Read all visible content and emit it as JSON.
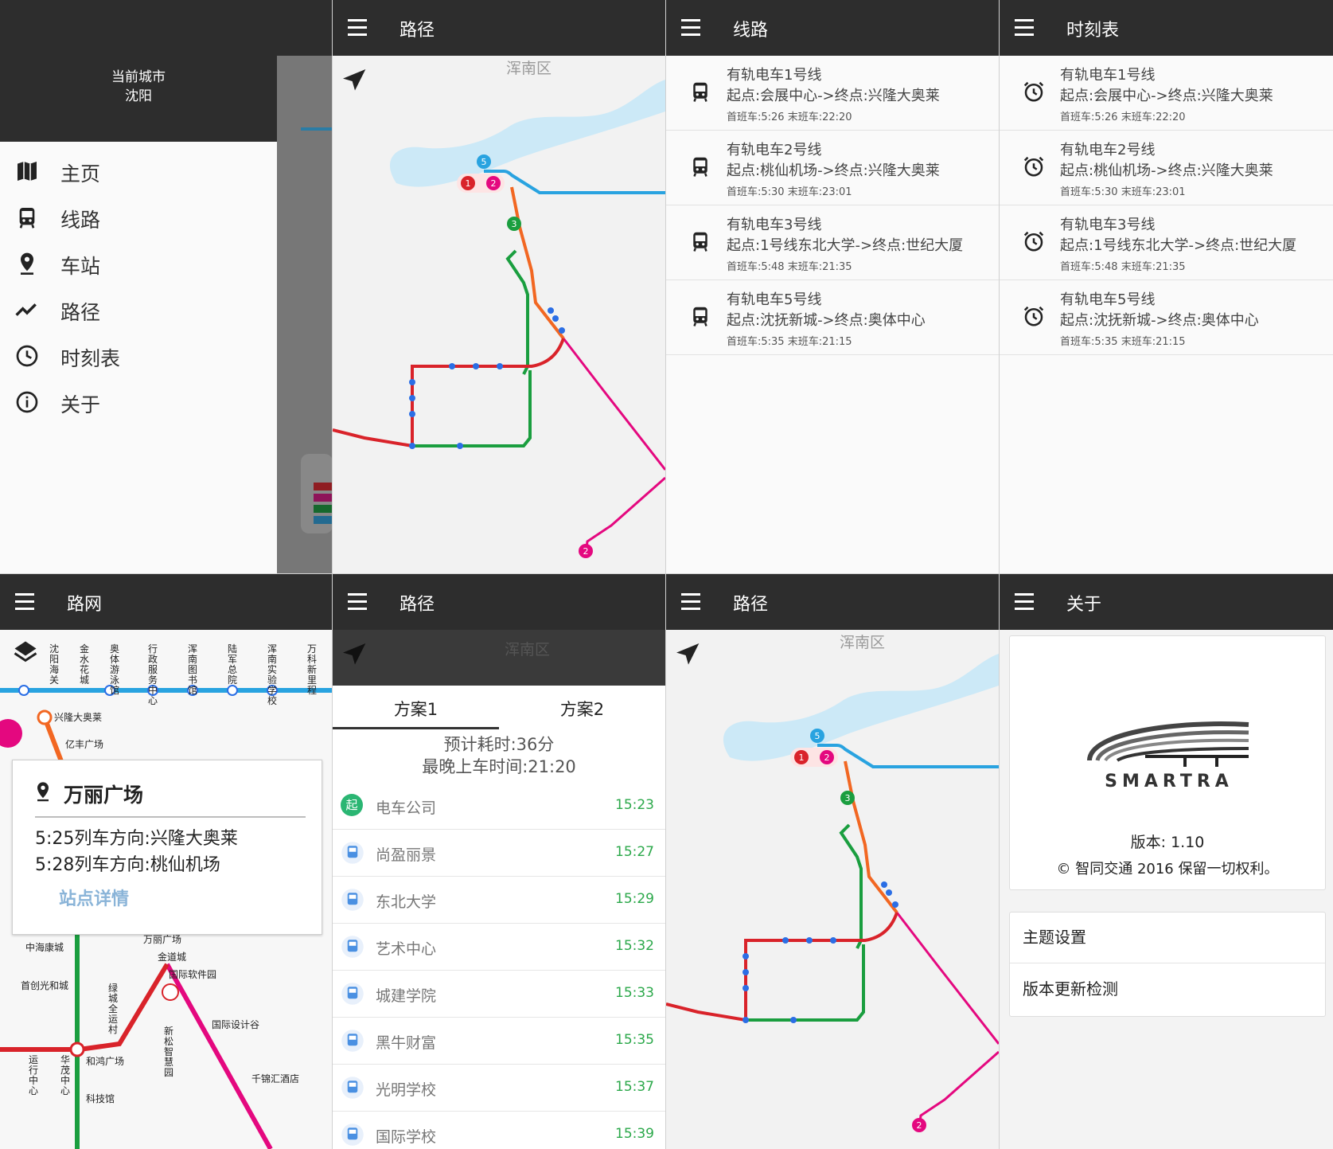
{
  "drawer": {
    "current_city_label": "当前城市",
    "current_city": "沈阳",
    "items": [
      {
        "label": "主页",
        "icon": "map-icon"
      },
      {
        "label": "线路",
        "icon": "tram-icon"
      },
      {
        "label": "车站",
        "icon": "location-pin-icon"
      },
      {
        "label": "路径",
        "icon": "route-icon"
      },
      {
        "label": "时刻表",
        "icon": "clock-icon"
      },
      {
        "label": "关于",
        "icon": "info-icon"
      }
    ]
  },
  "route_map": {
    "title": "路径",
    "district": "浑南区",
    "line_badges": [
      "5",
      "1",
      "2",
      "3",
      "2"
    ],
    "colors": {
      "line1": "#d9232a",
      "line2": "#e4087f",
      "line3": "#1a9e3f",
      "line5": "#29a3e0",
      "line_orange": "#f26722"
    }
  },
  "lines": {
    "title": "线路",
    "items": [
      {
        "name": "有轨电车1号线",
        "route": "起点:会展中心->终点:兴隆大奥莱",
        "hours": "首班车:5:26 末班车:22:20"
      },
      {
        "name": "有轨电车2号线",
        "route": "起点:桃仙机场->终点:兴隆大奥莱",
        "hours": "首班车:5:30 末班车:23:01"
      },
      {
        "name": "有轨电车3号线",
        "route": "起点:1号线东北大学->终点:世纪大厦",
        "hours": "首班车:5:48 末班车:21:35"
      },
      {
        "name": "有轨电车5号线",
        "route": "起点:沈抚新城->终点:奥体中心",
        "hours": "首班车:5:35 末班车:21:15"
      }
    ]
  },
  "timetable": {
    "title": "时刻表",
    "items": [
      {
        "name": "有轨电车1号线",
        "route": "起点:会展中心->终点:兴隆大奥莱",
        "hours": "首班车:5:26 末班车:22:20"
      },
      {
        "name": "有轨电车2号线",
        "route": "起点:桃仙机场->终点:兴隆大奥莱",
        "hours": "首班车:5:30 末班车:23:01"
      },
      {
        "name": "有轨电车3号线",
        "route": "起点:1号线东北大学->终点:世纪大厦",
        "hours": "首班车:5:48 末班车:21:35"
      },
      {
        "name": "有轨电车5号线",
        "route": "起点:沈抚新城->终点:奥体中心",
        "hours": "首班车:5:35 末班车:21:15"
      }
    ]
  },
  "network": {
    "title": "路网",
    "top_station_labels": [
      "沈阳海关",
      "金水花城",
      "奥体游泳馆",
      "行政服务中心",
      "浑南图书馆",
      "陆军总院",
      "浑南实验学校",
      "万科新里程"
    ],
    "labels": {
      "xinglong": "兴隆大奥莱",
      "yifeng": "亿丰广场",
      "wanli": "万丽广场",
      "jindao": "金道城",
      "guojiruanjian": "国际软件园",
      "guojisheji": "国际设计谷",
      "qianjin": "千锦汇酒店",
      "zhonghai": "中海康城",
      "shouchuang": "首创光和城",
      "heihong": "和鸿广场",
      "keji": "科技馆",
      "lvcheng": "绿城全运村",
      "xinsong": "新松智慧园",
      "yunxing": "运行中心",
      "huamao": "华茂中心"
    },
    "popup": {
      "station": "万丽广场",
      "train1": "5:25列车方向:兴隆大奥莱",
      "train2": "5:28列车方向:桃仙机场",
      "link": "站点详情"
    }
  },
  "plan": {
    "title": "路径",
    "district": "浑南区",
    "tabs": [
      "方案1",
      "方案2"
    ],
    "estimate": "预计耗时:36分",
    "last_boarding": "最晚上车时间:21:20",
    "start_badge": "起",
    "stops": [
      {
        "name": "电车公司",
        "time": "15:23"
      },
      {
        "name": "尚盈丽景",
        "time": "15:27"
      },
      {
        "name": "东北大学",
        "time": "15:29"
      },
      {
        "name": "艺术中心",
        "time": "15:32"
      },
      {
        "name": "城建学院",
        "time": "15:33"
      },
      {
        "name": "黑牛财富",
        "time": "15:35"
      },
      {
        "name": "光明学校",
        "time": "15:37"
      },
      {
        "name": "国际学校",
        "time": "15:39"
      }
    ]
  },
  "route_map2": {
    "title": "路径",
    "district": "浑南区"
  },
  "about": {
    "title": "关于",
    "logo_text": "SMARTRA",
    "version": "版本: 1.10",
    "copyright": "© 智同交通 2016 保留一切权利。",
    "buttons": [
      "主题设置",
      "版本更新检测"
    ]
  }
}
